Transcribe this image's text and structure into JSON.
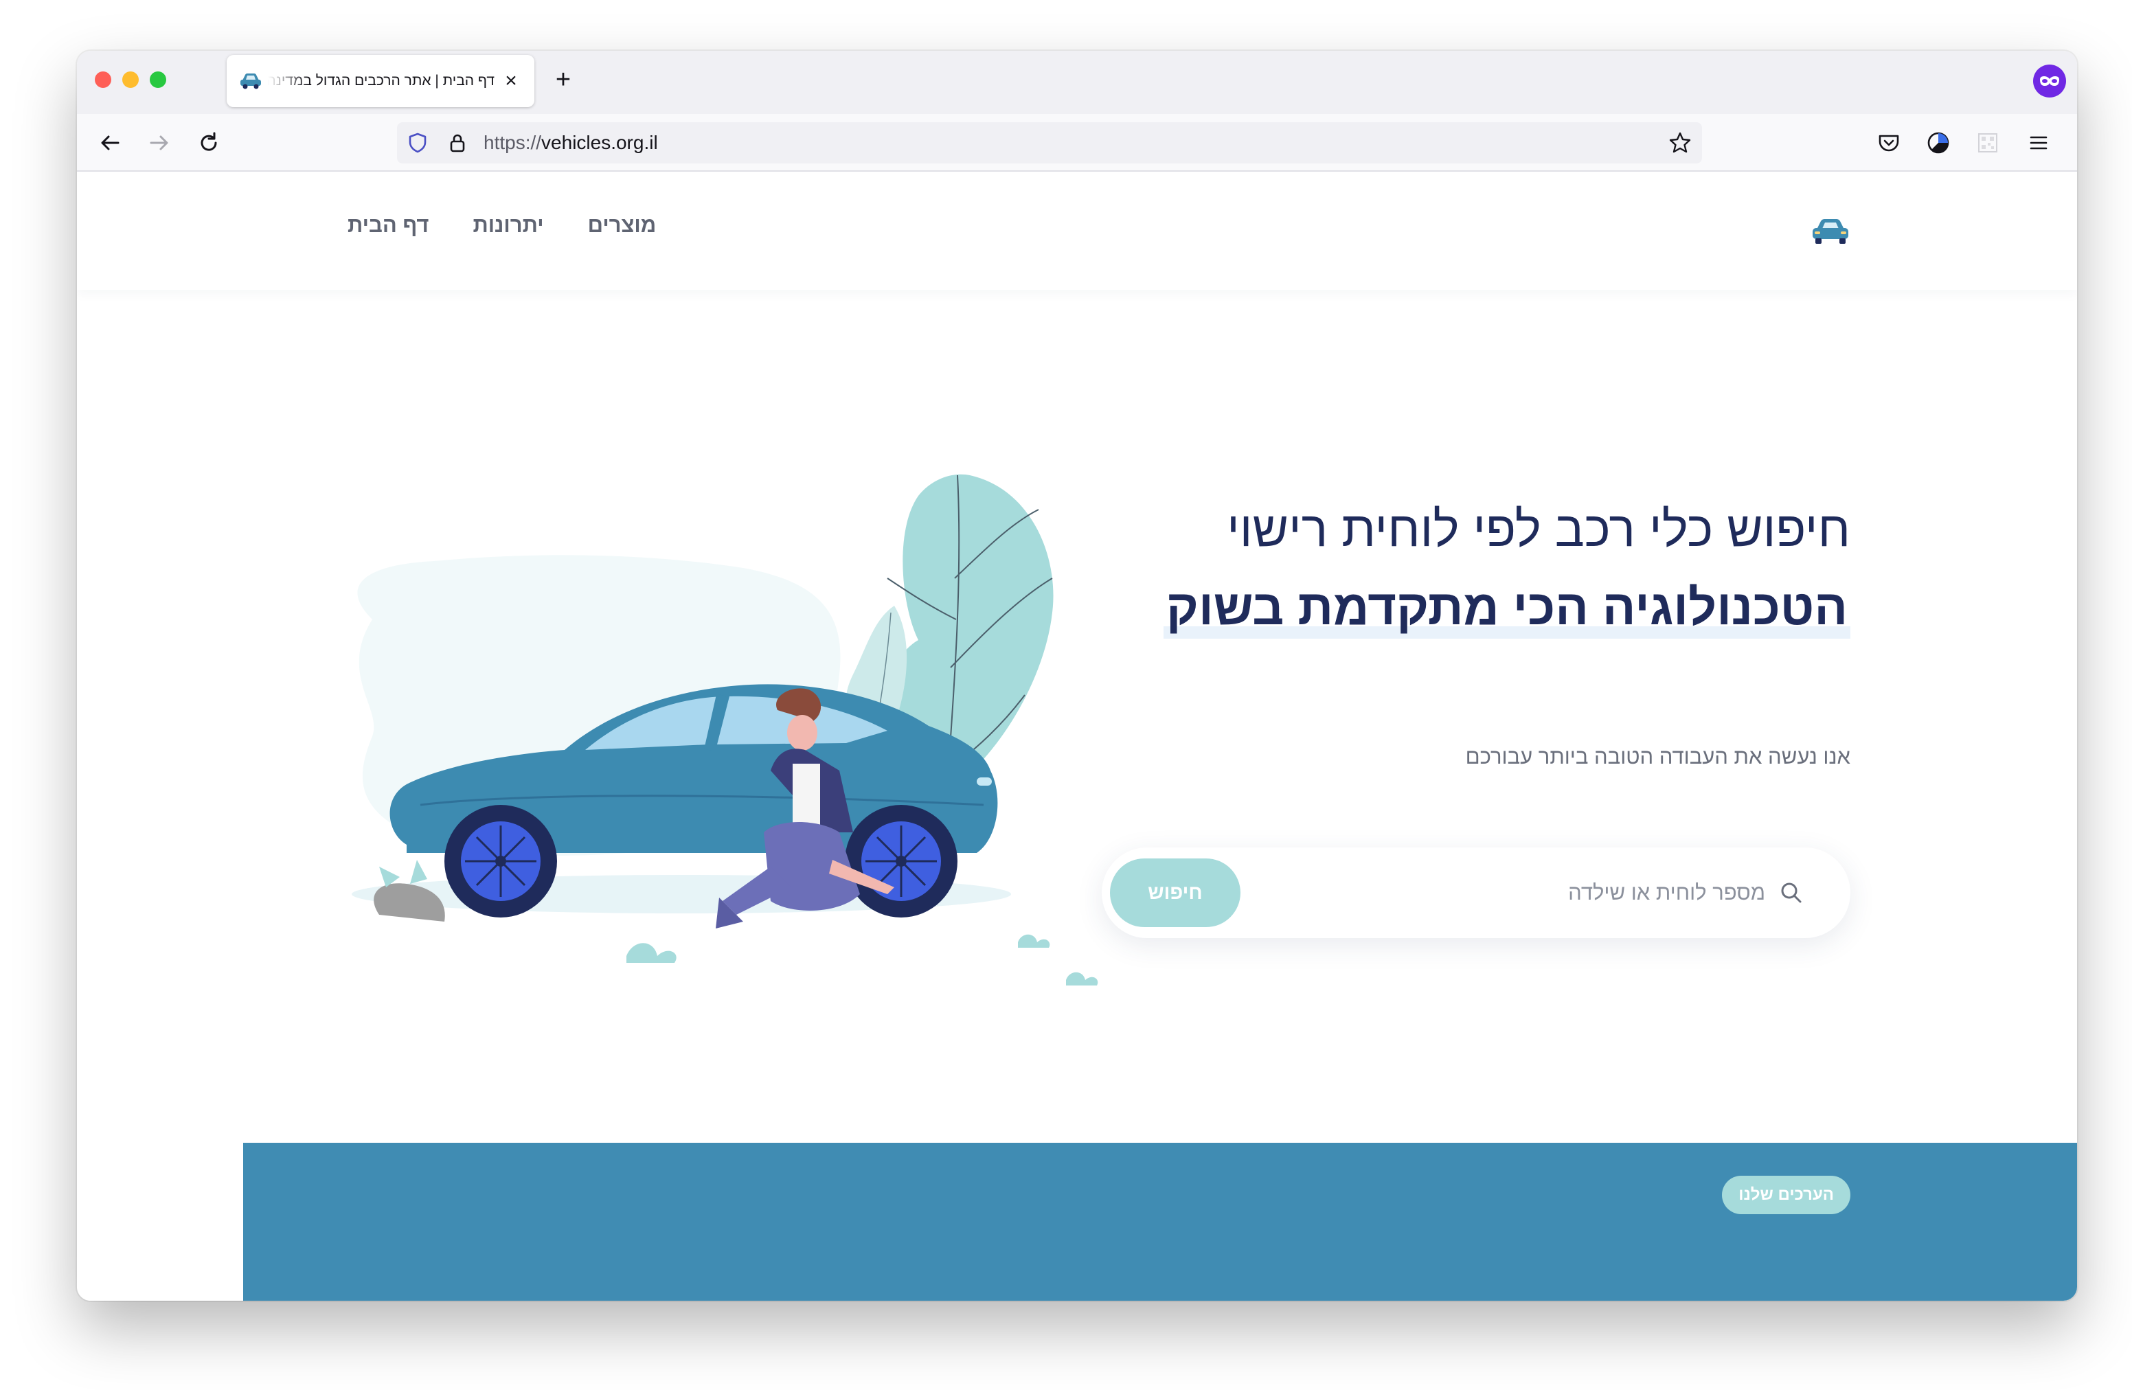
{
  "browser": {
    "tab_title": "דף הבית | אתר הרכבים הגדול במדינה",
    "tab_favicon": "car-icon",
    "close_tab_icon": "close-icon",
    "new_tab_label": "+",
    "url_scheme": "https://",
    "url_host": "vehicles.org.il",
    "toolbar_icons": [
      "back-arrow-icon",
      "forward-arrow-icon",
      "reload-icon",
      "shield-icon",
      "lock-icon",
      "bookmark-star-icon",
      "pocket-icon",
      "extension-icon",
      "qr-icon",
      "hamburger-menu-icon",
      "private-mask-icon"
    ]
  },
  "site": {
    "logo_icon": "car-icon",
    "nav": {
      "home": "דף הבית",
      "advantages": "יתרונות",
      "products": "מוצרים"
    },
    "hero": {
      "title_line1": "חיפוש כלי רכב לפי לוחית רישוי",
      "title_line2": "הטכנולוגיה הכי מתקדמת בשוק",
      "subtitle": "אנו נעשה את העבודה הטובה ביותר עבורכם"
    },
    "search": {
      "placeholder": "מספר לוחית או שילדה",
      "value": "",
      "button_label": "חיפוש"
    },
    "values_badge": "הערכים שלנו"
  },
  "colors": {
    "brand_navy": "#1f2b5b",
    "accent_teal": "#a6dbdb",
    "band_blue": "#408cb3",
    "car_blue": "#3d8bb1",
    "wheel_blue": "#3f5fe0"
  }
}
